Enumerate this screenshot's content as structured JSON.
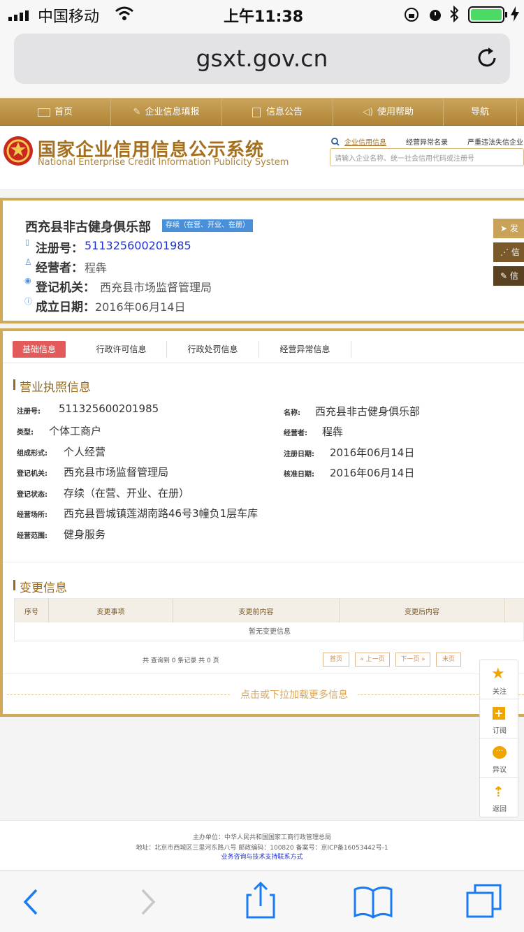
{
  "status": {
    "carrier": "中国移动",
    "time": "上午11:38"
  },
  "url": "gsxt.gov.cn",
  "nav": {
    "items": [
      "首页",
      "企业信息填报",
      "信息公告",
      "使用帮助",
      "导航"
    ]
  },
  "header": {
    "title_cn": "国家企业信用信息公示系统",
    "title_en": "National Enterprise Credit Information Publicity System",
    "links": [
      "企业信用信息",
      "经营异常名录",
      "严重违法失信企业"
    ],
    "search_placeholder": "请输入企业名称、统一社会信用代码或注册号"
  },
  "company": {
    "name": "西充县非古健身俱乐部",
    "status_badge": "存续（在营、开业、在册）",
    "reg_label": "注册号：",
    "reg_value": "511325600201985",
    "operator_label": "经营者：",
    "operator_value": "程犇",
    "authority_label": "登记机关：",
    "authority_value": "西充县市场监督管理局",
    "date_label": "成立日期：",
    "date_value": "2016年06月14日",
    "side_buttons": [
      "发",
      "信",
      "信"
    ]
  },
  "tabs": [
    "基础信息",
    "行政许可信息",
    "行政处罚信息",
    "经营异常信息"
  ],
  "license": {
    "title": "营业执照信息",
    "left": [
      {
        "label": "注册号:",
        "value": "511325600201985"
      },
      {
        "label": "类型:",
        "value": "个体工商户"
      },
      {
        "label": "组成形式:",
        "value": "个人经营"
      },
      {
        "label": "登记机关:",
        "value": "西充县市场监督管理局"
      },
      {
        "label": "登记状态:",
        "value": "存续（在营、开业、在册）"
      },
      {
        "label": "经营场所:",
        "value": "西充县晋城镇莲湖南路46号3幢负1层车库"
      },
      {
        "label": "经营范围:",
        "value": "健身服务"
      }
    ],
    "right": [
      {
        "label": "名称:",
        "value": "西充县非古健身俱乐部"
      },
      {
        "label": "经营者:",
        "value": "程犇"
      },
      {
        "label": "注册日期:",
        "value": "2016年06月14日"
      },
      {
        "label": "核准日期:",
        "value": "2016年06月14日"
      }
    ]
  },
  "changes": {
    "title": "变更信息",
    "columns": [
      "序号",
      "变更事项",
      "变更前内容",
      "变更后内容"
    ],
    "empty": "暂无变更信息",
    "summary": "共 查询到 0 条记录 共 0 页",
    "pager": [
      "首页",
      "« 上一页",
      "下一页 »",
      "末页"
    ],
    "load_more": "点击或下拉加载更多信息"
  },
  "side_panel": [
    "关注",
    "订阅",
    "异议",
    "返回"
  ],
  "footer": {
    "line1": "主办单位：中华人民共和国国家工商行政管理总局",
    "line2": "地址：北京市西城区三里河东路八号   邮政编码：100820   备案号：京ICP备16053442号-1",
    "line3": "业务咨询与技术支持联系方式"
  },
  "colors": {
    "gold": "#c9a25a",
    "blue_link": "#2233cc",
    "badge": "#4a90d9",
    "tab_active": "#e25a5a"
  }
}
